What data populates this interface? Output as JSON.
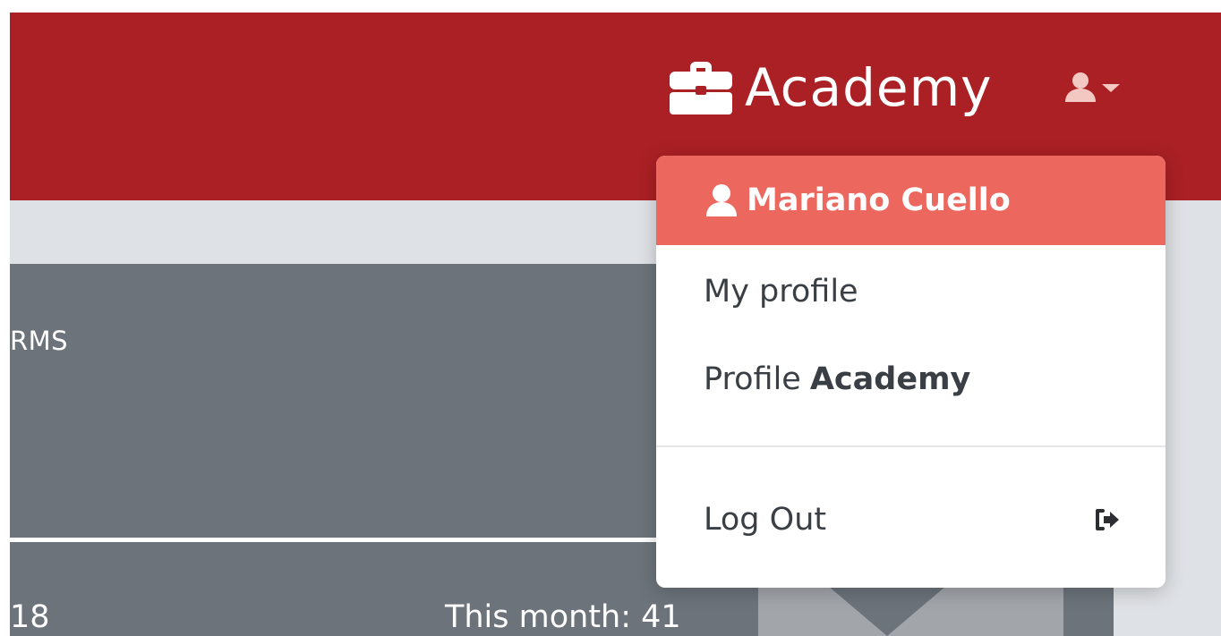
{
  "navbar": {
    "brand_icon": "briefcase-icon",
    "brand_text": "Academy",
    "user_icon": "user-icon",
    "caret_icon": "caret-down-icon",
    "background_color": "#aa2024"
  },
  "card": {
    "title": "RMS",
    "stat_left": "18",
    "stat_right": "This month: 41"
  },
  "user_menu": {
    "header_icon": "user-icon",
    "user_name": "Mariano Cuello",
    "header_color": "#ec675e",
    "items": [
      {
        "label": "My profile"
      },
      {
        "label": "Profile",
        "label_bold": "Academy"
      }
    ],
    "logout": {
      "label": "Log Out",
      "icon": "sign-out-icon"
    }
  }
}
